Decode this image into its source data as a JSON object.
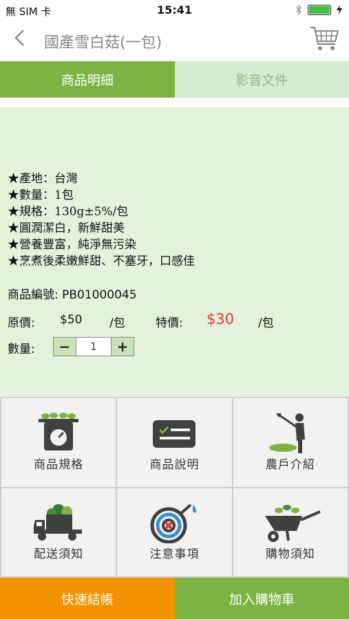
{
  "status_bar": {
    "carrier": "無 SIM 卡",
    "time": "15:41"
  },
  "nav": {
    "title": "國產雪白菇(一包)",
    "back_icon": "chevron-left-icon",
    "cart_icon": "cart-icon"
  },
  "tabs": [
    {
      "label": "商品明細",
      "active": true
    },
    {
      "label": "影音文件",
      "active": false
    }
  ],
  "details": {
    "features": [
      "★產地：台灣",
      "★數量：1包",
      "★規格：130g±5%/包",
      "★圓潤潔白，新鮮甜美",
      "★營養豐富，純淨無污染",
      "★烹煮後柔嫩鮮甜、不塞牙，口感佳"
    ],
    "product_no": "商品編號: PB01000045",
    "price": {
      "original_label": "原價:",
      "original_value": "$50",
      "original_unit": "/包",
      "special_label": "特價:",
      "special_value": "$30",
      "special_unit": "/包"
    },
    "quantity": {
      "label": "數量:",
      "value": "1",
      "minus": "−",
      "plus": "+"
    }
  },
  "menu": [
    {
      "label": "商品規格",
      "icon": "scale-icon"
    },
    {
      "label": "商品說明",
      "icon": "card-icon"
    },
    {
      "label": "農戶介紹",
      "icon": "farmer-icon"
    },
    {
      "label": "配送須知",
      "icon": "truck-icon"
    },
    {
      "label": "注意事項",
      "icon": "hose-icon"
    },
    {
      "label": "購物須知",
      "icon": "wheelbarrow-icon"
    }
  ],
  "bottom": {
    "checkout": "快速結帳",
    "add_to_cart": "加入購物車"
  },
  "colors": {
    "green": "#7cb342",
    "orange": "#f39200",
    "special_price": "#e53935",
    "content_bg": "#e4f2dc"
  }
}
